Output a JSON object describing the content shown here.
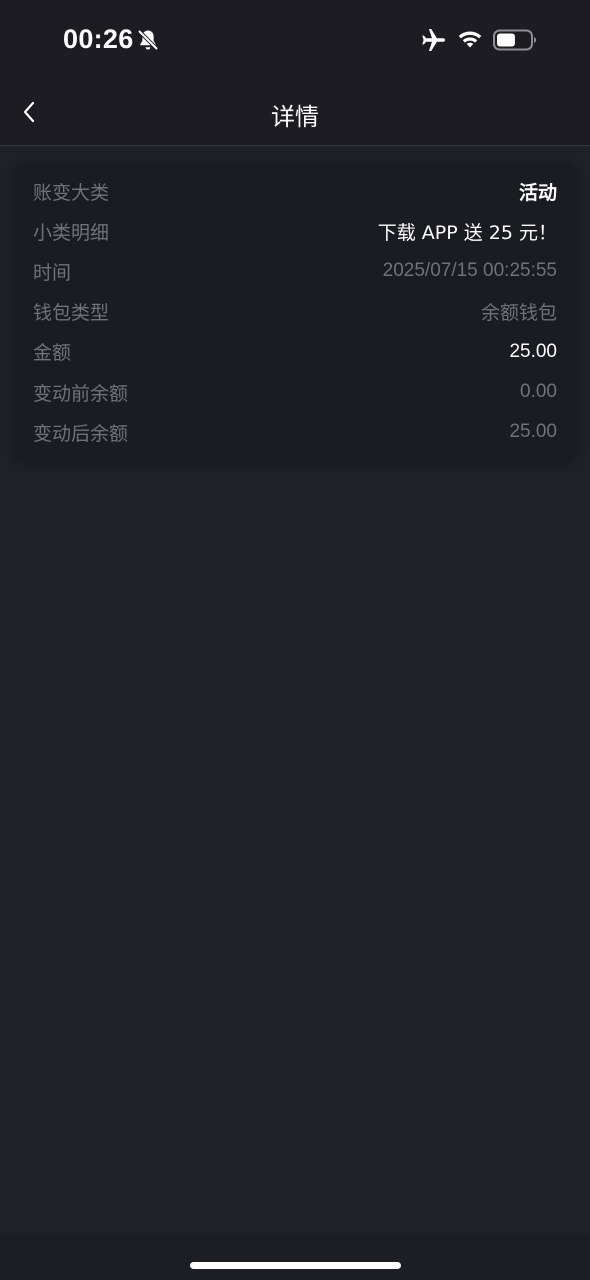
{
  "status_bar": {
    "time": "00:26",
    "icons": [
      "bell-slash-icon",
      "airplane-icon",
      "wifi-icon",
      "battery-icon"
    ]
  },
  "nav": {
    "title": "详情",
    "back_icon": "chevron-left-icon"
  },
  "details": {
    "rows": [
      {
        "label": "账变大类",
        "value": "活动"
      },
      {
        "label": "小类明细",
        "value": "下载 APP 送 25 元！"
      },
      {
        "label": "时间",
        "value": "2025/07/15 00:25:55"
      },
      {
        "label": "钱包类型",
        "value": "余额钱包"
      },
      {
        "label": "金额",
        "value": "25.00"
      },
      {
        "label": "变动前余额",
        "value": "0.00"
      },
      {
        "label": "变动后余额",
        "value": "25.00"
      }
    ]
  },
  "colors": {
    "background": "#202128",
    "card": "#1b1c22",
    "label": "#6f717b",
    "value_highlight": "#ffffff"
  }
}
